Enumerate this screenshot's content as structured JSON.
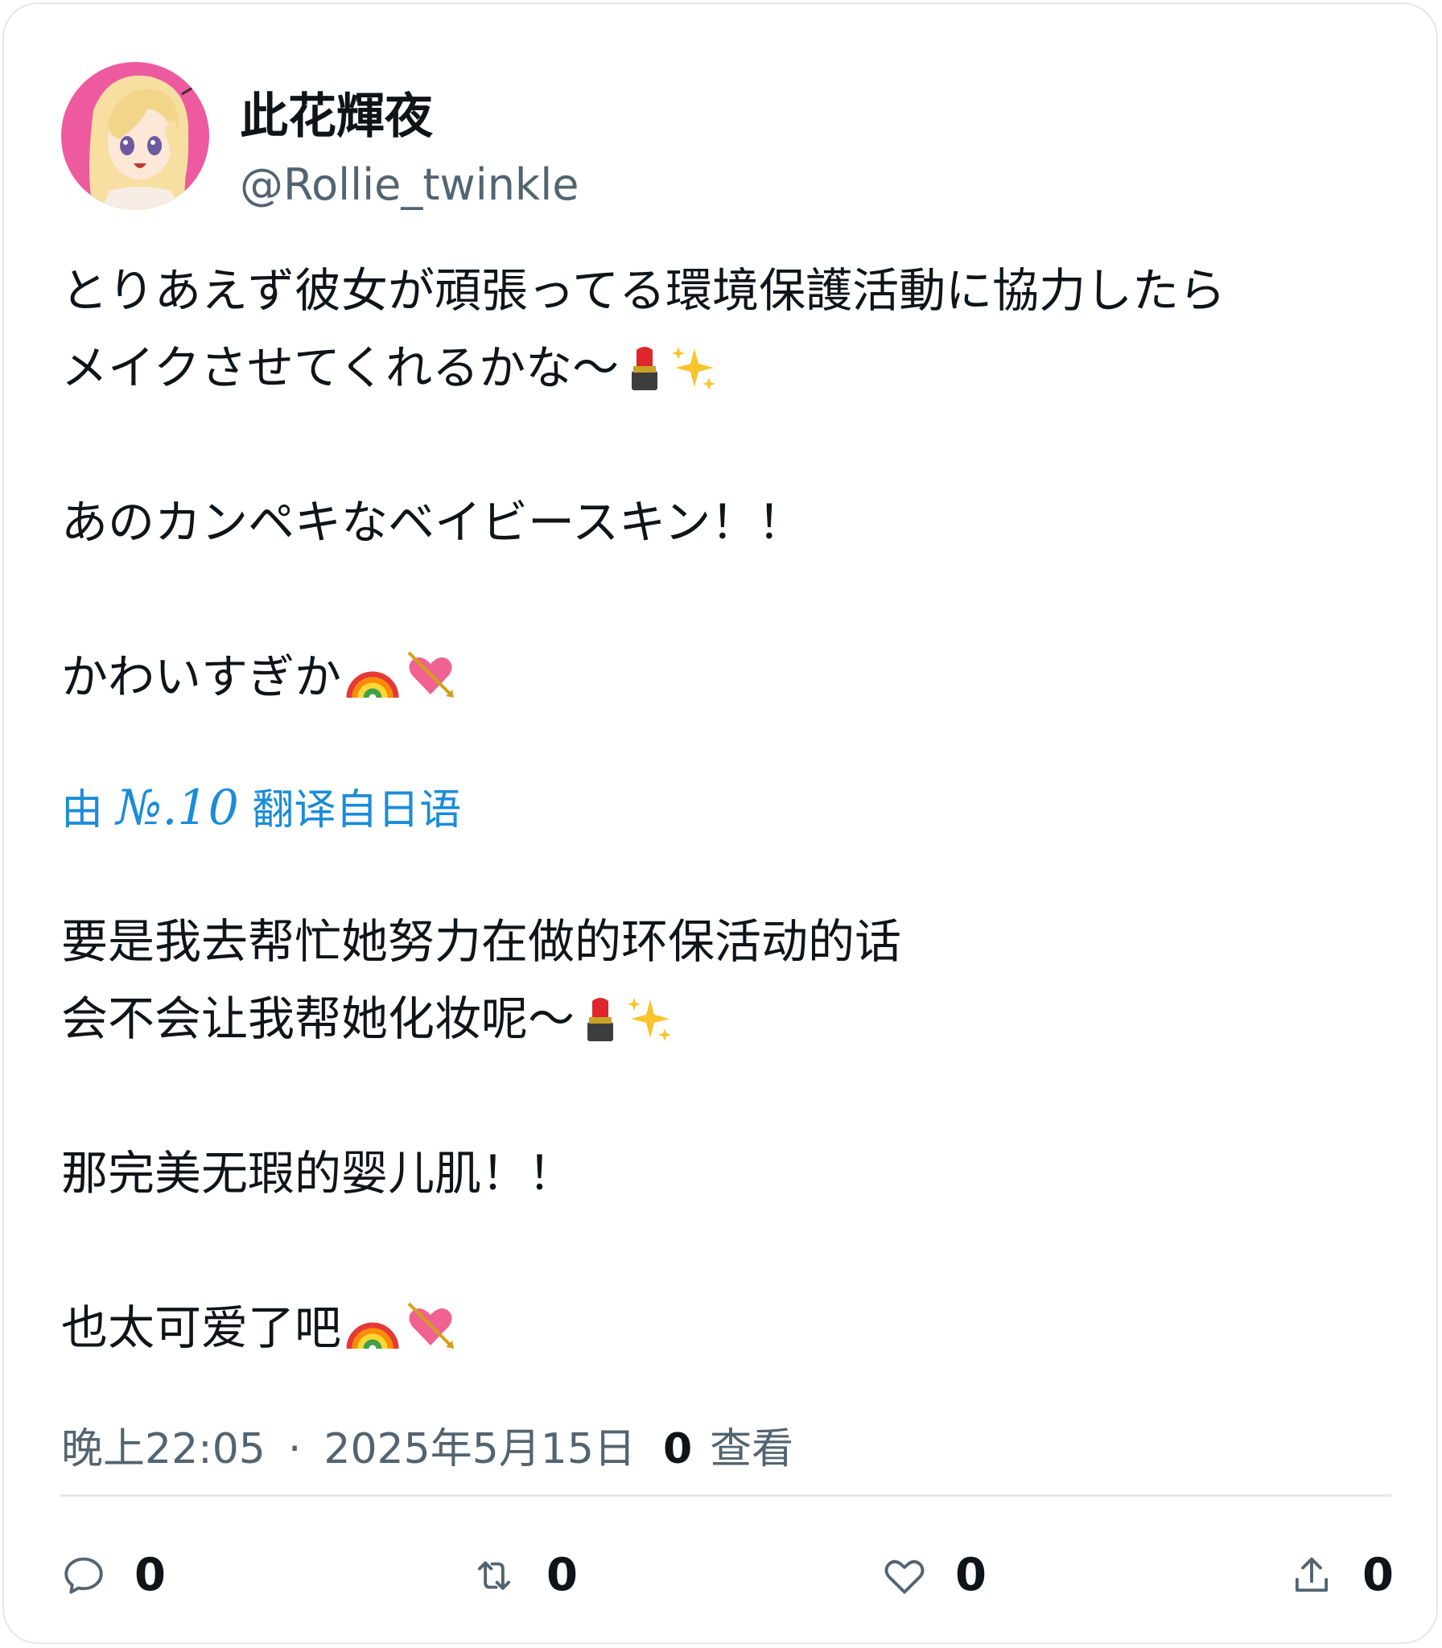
{
  "author": {
    "display_name": "此花輝夜",
    "handle": "@Rollie_twinkle"
  },
  "tweet": {
    "original_lines": [
      "とりあえず彼女が頑張ってる環境保護活動に協力したら",
      "メイクさせてくれるかな〜",
      "あのカンペキなベイビースキン！！",
      "かわいすぎか"
    ],
    "translation_note": {
      "prefix": "由",
      "brand": "№.10",
      "suffix": "翻译自日语"
    },
    "translated_lines": [
      "要是我去帮忙她努力在做的环保活动的话",
      "会不会让我帮她化妆呢〜",
      "那完美无瑕的婴儿肌！！",
      "也太可爱了吧"
    ]
  },
  "meta": {
    "time": "晚上22:05",
    "separator": "·",
    "date": "2025年5月15日",
    "views_count": "0",
    "views_label": "查看"
  },
  "actions": {
    "reply_count": "0",
    "retweet_count": "0",
    "like_count": "0",
    "share_count": "0"
  },
  "icons": {
    "avatar": "anime-girl-avatar-icon",
    "lipstick": "lipstick-icon",
    "sparkles": "sparkles-icon",
    "rainbow": "rainbow-icon",
    "heart_arrow": "heart-with-arrow-icon",
    "reply": "reply-icon",
    "retweet": "retweet-icon",
    "like": "like-icon",
    "share": "share-icon"
  },
  "colors": {
    "text": "#0f1419",
    "secondary": "#536471",
    "translate_link": "#1a8cd8",
    "avatar_bg": "#ee5aa0",
    "border": "#e4e7ea"
  }
}
